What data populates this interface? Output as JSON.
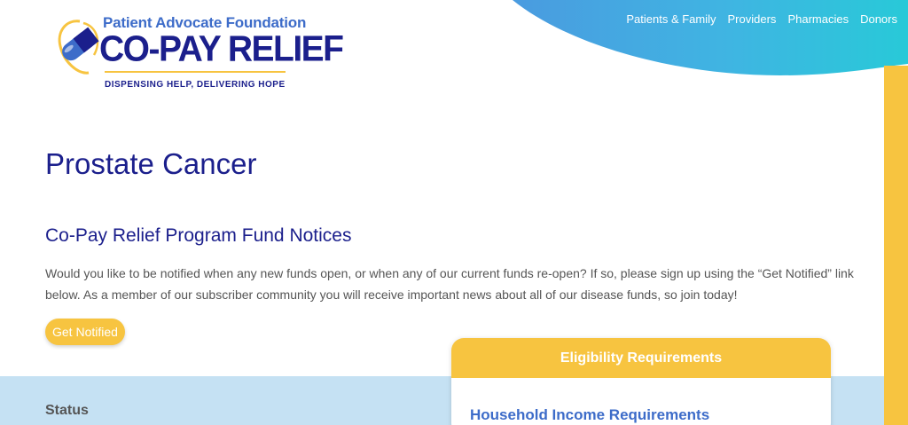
{
  "brand": {
    "org_name": "Patient Advocate Foundation",
    "product_name": "CO-PAY RELIEF",
    "trademark": "SM",
    "tagline": "DISPENSING HELP, DELIVERING HOPE",
    "colors": {
      "navy": "#1b1f8c",
      "blue": "#3d6cc9",
      "yellow": "#f7c440",
      "light_blue": "#c5e1f3",
      "sky": "#4aaae0"
    }
  },
  "nav": {
    "items": [
      {
        "label": "Patients & Family"
      },
      {
        "label": "Providers"
      },
      {
        "label": "Pharmacies"
      },
      {
        "label": "Donors"
      }
    ]
  },
  "main": {
    "title": "Prostate Cancer",
    "notices_heading": "Co-Pay Relief Program Fund Notices",
    "notices_text": "Would you like to be notified when any new funds open, or when any of our current funds re-open? If so, please sign up using the “Get Notified” link below. As a member of our subscriber community you will receive important news about all of our disease funds, so join today!",
    "notify_button": "Get Notified",
    "status_label": "Status"
  },
  "eligibility": {
    "heading": "Eligibility Requirements",
    "income_heading": "Household Income Requirements"
  }
}
